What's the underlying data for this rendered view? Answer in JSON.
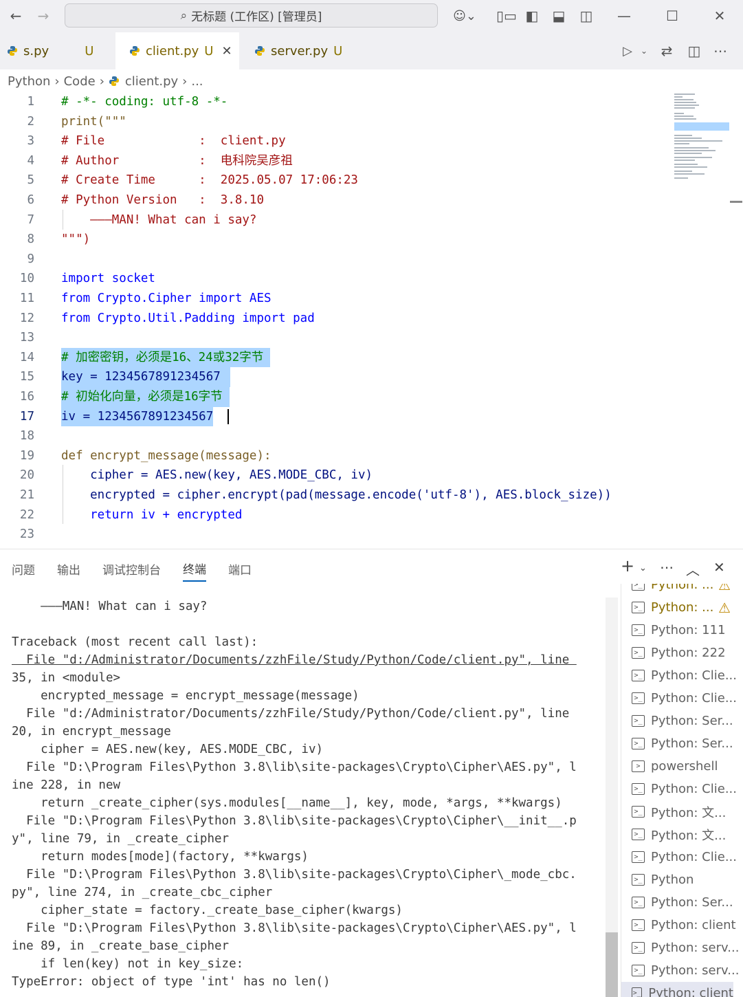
{
  "window": {
    "title": "无标题 (工作区) [管理员]"
  },
  "tabs": [
    {
      "label": "s.py",
      "status": "U"
    },
    {
      "label": "client.py",
      "status": "U",
      "close": "✕"
    },
    {
      "label": "server.py",
      "status": "U"
    }
  ],
  "breadcrumb": {
    "items": [
      "Python",
      "Code",
      "client.py",
      "..."
    ]
  },
  "editor": {
    "lines": [
      {
        "n": "1",
        "text": "# -*- coding: utf-8 -*-"
      },
      {
        "n": "2",
        "text": "print(\"\"\""
      },
      {
        "n": "3",
        "text": "# File             :  client.py"
      },
      {
        "n": "4",
        "text": "# Author           :  电科院吴彦祖"
      },
      {
        "n": "5",
        "text": "# Create Time      :  2025.05.07 17:06:23"
      },
      {
        "n": "6",
        "text": "# Python Version   :  3.8.10"
      },
      {
        "n": "7",
        "text": "    ———MAN! What can i say?"
      },
      {
        "n": "8",
        "text": "\"\"\")"
      },
      {
        "n": "9",
        "text": ""
      },
      {
        "n": "10",
        "text": "import socket"
      },
      {
        "n": "11",
        "text": "from Crypto.Cipher import AES"
      },
      {
        "n": "12",
        "text": "from Crypto.Util.Padding import pad"
      },
      {
        "n": "13",
        "text": ""
      },
      {
        "n": "14",
        "text": "# 加密密钥，必须是16、24或32字节"
      },
      {
        "n": "15",
        "text": "key = 1234567891234567"
      },
      {
        "n": "16",
        "text": "# 初始化向量，必须是16字节"
      },
      {
        "n": "17",
        "text": "iv = 1234567891234567"
      },
      {
        "n": "18",
        "text": ""
      },
      {
        "n": "19",
        "text": "def encrypt_message(message):"
      },
      {
        "n": "20",
        "text": "    cipher = AES.new(key, AES.MODE_CBC, iv)"
      },
      {
        "n": "21",
        "text": "    encrypted = cipher.encrypt(pad(message.encode('utf-8'), AES.block_size))"
      },
      {
        "n": "22",
        "text": "    return iv + encrypted"
      },
      {
        "n": "23",
        "text": ""
      }
    ]
  },
  "panel": {
    "tabs": [
      "问题",
      "输出",
      "调试控制台",
      "终端",
      "端口"
    ],
    "active_tab": "终端"
  },
  "terminal": {
    "lines": [
      "    ———MAN! What can i say?",
      "",
      "Traceback (most recent call last):",
      "  File \"d:/Administrator/Documents/zzhFile/Study/Python/Code/client.py\", line ",
      "35, in <module>",
      "    encrypted_message = encrypt_message(message)",
      "  File \"d:/Administrator/Documents/zzhFile/Study/Python/Code/client.py\", line",
      "20, in encrypt_message",
      "    cipher = AES.new(key, AES.MODE_CBC, iv)",
      "  File \"D:\\Program Files\\Python 3.8\\lib\\site-packages\\Crypto\\Cipher\\AES.py\", l",
      "ine 228, in new",
      "    return _create_cipher(sys.modules[__name__], key, mode, *args, **kwargs)",
      "  File \"D:\\Program Files\\Python 3.8\\lib\\site-packages\\Crypto\\Cipher\\__init__.p",
      "y\", line 79, in _create_cipher",
      "    return modes[mode](factory, **kwargs)",
      "  File \"D:\\Program Files\\Python 3.8\\lib\\site-packages\\Crypto\\Cipher\\_mode_cbc.",
      "py\", line 274, in _create_cbc_cipher",
      "    cipher_state = factory._create_base_cipher(kwargs)",
      "  File \"D:\\Program Files\\Python 3.8\\lib\\site-packages\\Crypto\\Cipher\\AES.py\", l",
      "ine 89, in _create_base_cipher",
      "    if len(key) not in key_size:",
      "TypeError: object of type 'int' has no len()"
    ]
  },
  "terminal_list": [
    {
      "label": "Python: ...",
      "warn": true
    },
    {
      "label": "Python: ...",
      "warn": true
    },
    {
      "label": "Python: 111"
    },
    {
      "label": "Python: 222"
    },
    {
      "label": "Python: Clie..."
    },
    {
      "label": "Python: Clie..."
    },
    {
      "label": "Python: Ser..."
    },
    {
      "label": "Python: Ser..."
    },
    {
      "label": "powershell"
    },
    {
      "label": "Python: Clie..."
    },
    {
      "label": "Python: 文..."
    },
    {
      "label": "Python: 文..."
    },
    {
      "label": "Python: Clie..."
    },
    {
      "label": "Python"
    },
    {
      "label": "Python: Ser..."
    },
    {
      "label": "Python: client"
    },
    {
      "label": "Python: serv..."
    },
    {
      "label": "Python: serv..."
    },
    {
      "label": "Python: client"
    }
  ],
  "colors": {
    "accent": "#005fb8",
    "selection": "#add6ff",
    "comment": "#008000",
    "string": "#a31515",
    "keyword": "#0000ff",
    "number": "#098658"
  }
}
